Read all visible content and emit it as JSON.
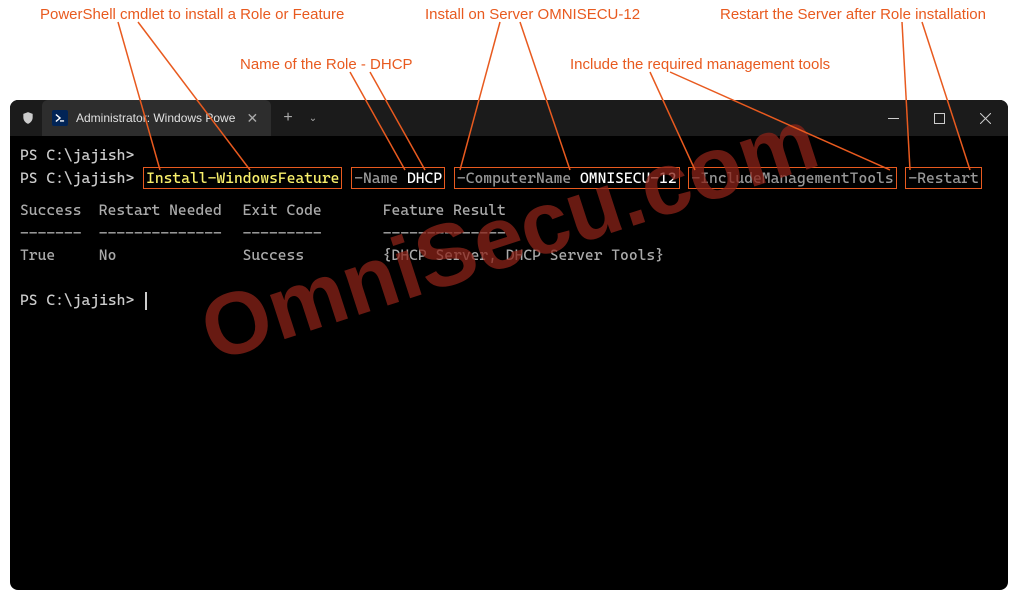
{
  "annotations": {
    "cmdlet": "PowerShell cmdlet to install a Role or Feature",
    "role_name": "Name of the Role - DHCP",
    "server": "Install on Server OMNISECU-12",
    "mgmt_tools": "Include the required management tools",
    "restart": "Restart the Server after Role installation"
  },
  "window": {
    "tab_title": "Administrator: Windows Powe"
  },
  "terminal": {
    "prompt": "PS C:\\jajish>",
    "command": {
      "cmdlet": "Install-WindowsFeature",
      "param_name": "-Name",
      "val_name": "DHCP",
      "param_computer": "-ComputerName",
      "val_computer": "OMNISECU-12",
      "param_mgmt": "-IncludeManagementTools",
      "param_restart": "-Restart"
    },
    "headers": {
      "success": "Success",
      "restart_needed": "Restart Needed",
      "exit_code": "Exit Code",
      "feature_result": "Feature Result"
    },
    "dashes": {
      "d1": "-------",
      "d2": "--------------",
      "d3": "---------",
      "d4": "--------------"
    },
    "result": {
      "success": "True",
      "restart_needed": "No",
      "exit_code": "Success",
      "feature_result": "{DHCP Server, DHCP Server Tools}"
    }
  },
  "watermark": "OmniSecu.com",
  "colors": {
    "accent": "#e85a1f"
  }
}
